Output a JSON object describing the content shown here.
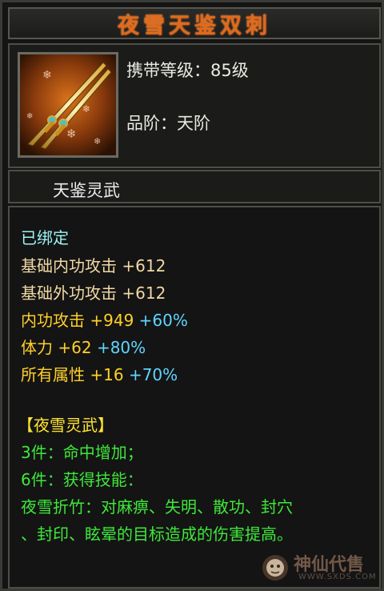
{
  "title": "夜雪天鉴双刺",
  "header": {
    "level_label": "携带等级：85级",
    "rank_label": "品阶：天阶"
  },
  "subtitle": "天鉴灵武",
  "bound": "已绑定",
  "stats": {
    "base_inner": {
      "label": "基础内功攻击",
      "value": "+612"
    },
    "base_outer": {
      "label": "基础外功攻击",
      "value": "+612"
    },
    "inner_attack": {
      "label": "内功攻击",
      "value": "+949",
      "bonus": "+60%"
    },
    "stamina": {
      "label": "体力",
      "value": "+62",
      "bonus": "+80%"
    },
    "all_attr": {
      "label": "所有属性",
      "value": "+16",
      "bonus": "+70%"
    }
  },
  "set": {
    "name": "【夜雪灵武】",
    "piece3": "3件：命中增加；",
    "piece6": "6件：获得技能：",
    "skill_line1": "夜雪折竹：对麻痹、失明、散功、封穴",
    "skill_line2": "、封印、眩晕的目标造成的伤害提高。"
  },
  "watermark": {
    "text": "神仙代售",
    "url": "WWW.SXDS.COM"
  },
  "colors": {
    "title": "#e06a1c",
    "set_name": "#ffe531",
    "set_text": "#3ee83a",
    "bonus": "#5fd6ff",
    "attr": "#ffd02a"
  }
}
